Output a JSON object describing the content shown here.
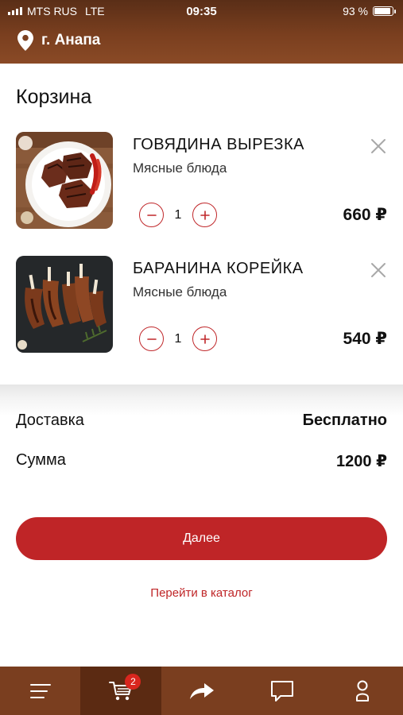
{
  "status_bar": {
    "carrier": "MTS RUS",
    "network": "LTE",
    "time": "09:35",
    "battery": "93 %",
    "battery_level": 0.93
  },
  "location": {
    "city": "г. Анапа",
    "icon": "location-pin-icon"
  },
  "page_title": "Корзина",
  "cart_items": [
    {
      "name": "ГОВЯДИНА ВЫРЕЗКА",
      "category": "Мясные блюда",
      "quantity": "1",
      "price": "660 ₽"
    },
    {
      "name": "БАРАНИНА КОРЕЙКА",
      "category": "Мясные блюда",
      "quantity": "1",
      "price": "540 ₽"
    }
  ],
  "summary": {
    "delivery_label": "Доставка",
    "delivery_value": "Бесплатно",
    "total_label": "Сумма",
    "total_value": "1200 ₽"
  },
  "actions": {
    "next_label": "Далее",
    "catalog_link": "Перейти в каталог"
  },
  "tab_bar": {
    "items": [
      {
        "icon": "menu-icon",
        "active": false
      },
      {
        "icon": "cart-icon",
        "active": true,
        "badge": "2"
      },
      {
        "icon": "share-icon",
        "active": false
      },
      {
        "icon": "chat-icon",
        "active": false
      },
      {
        "icon": "profile-icon",
        "active": false
      }
    ]
  },
  "colors": {
    "header_brown": "#7a3f1f",
    "accent_red": "#bf2527",
    "tab_bar_brown": "#7a3e1f",
    "tab_active_brown": "#5b2a12"
  }
}
